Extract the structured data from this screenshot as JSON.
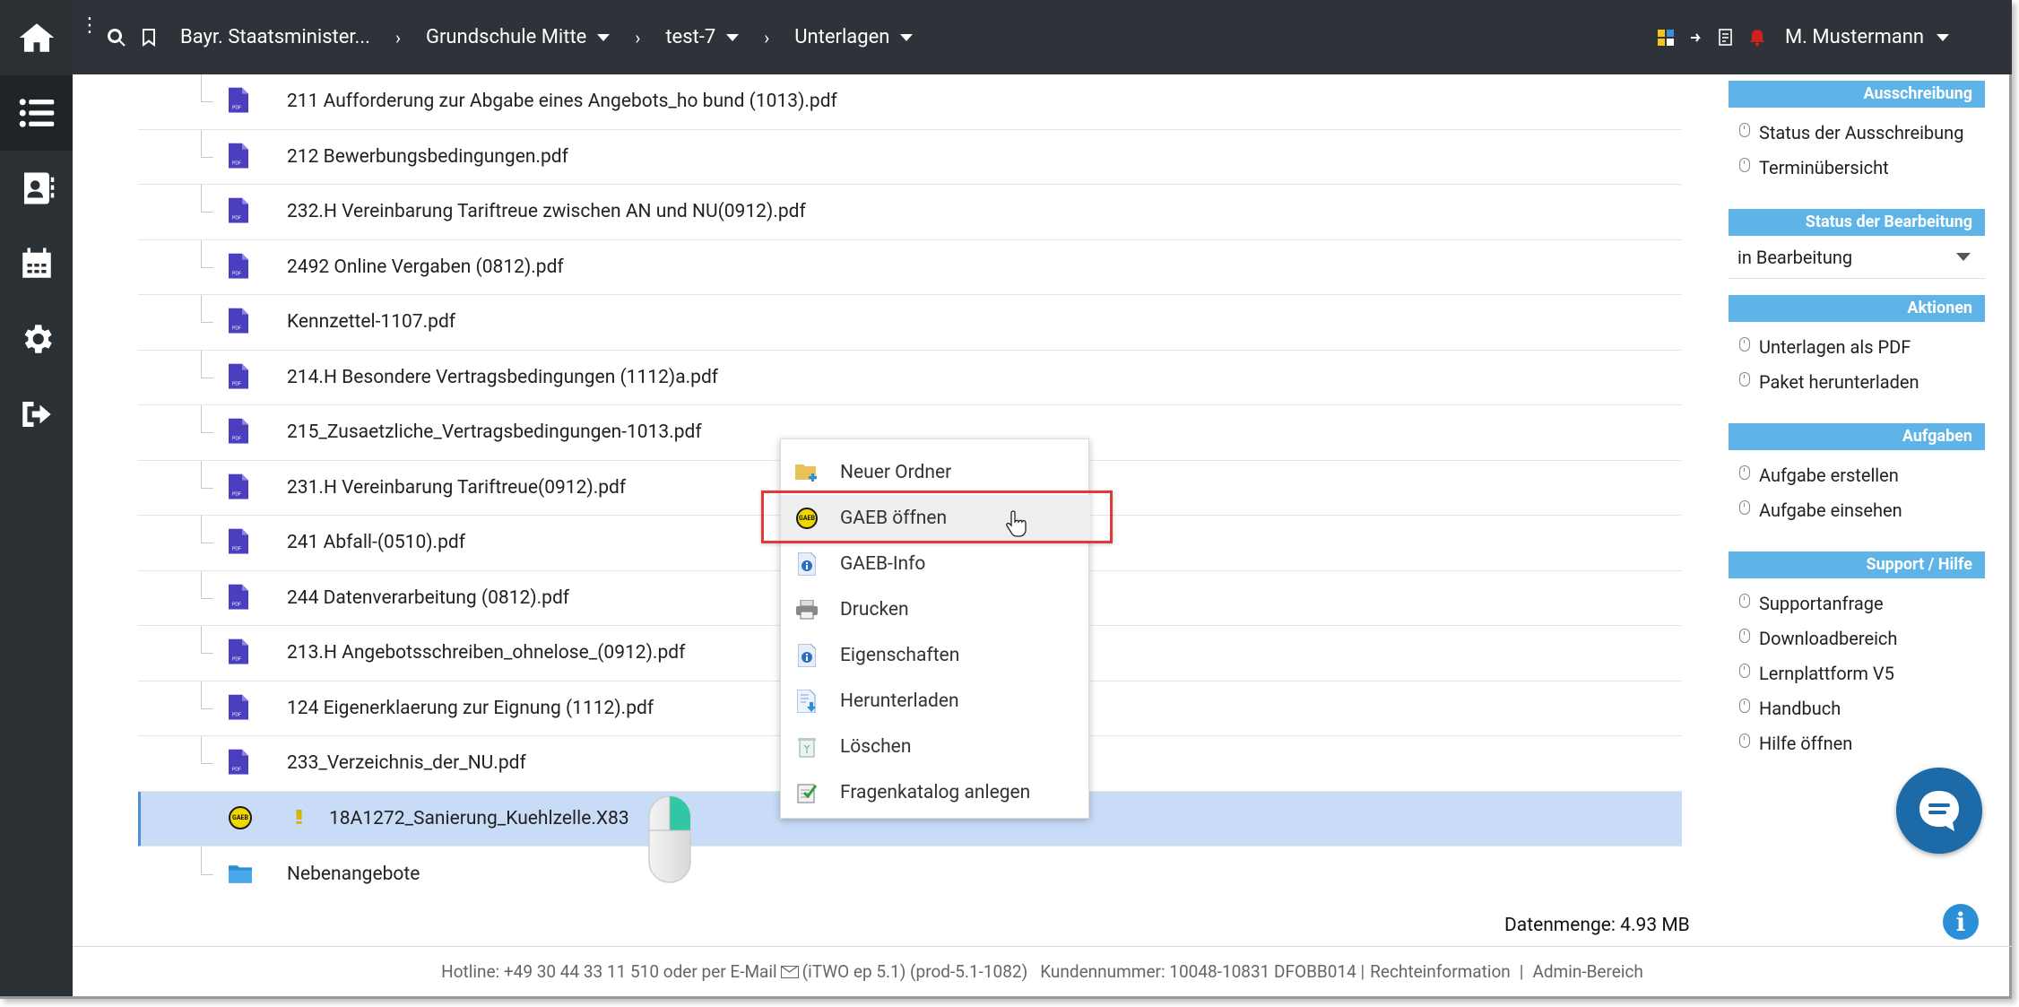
{
  "topbar": {
    "breadcrumbs": [
      {
        "label": "Bayr. Staatsminister...",
        "dropdown": false
      },
      {
        "label": "Grundschule Mitte",
        "dropdown": true
      },
      {
        "label": "test-7",
        "dropdown": true
      },
      {
        "label": "Unterlagen",
        "dropdown": true
      }
    ],
    "user": "M. Mustermann"
  },
  "leftnav": [
    "home-icon",
    "list-icon",
    "contacts-icon",
    "calendar-icon",
    "gear-icon",
    "logout-icon"
  ],
  "files": [
    {
      "name": "211 Aufforderung zur Abgabe eines Angebots_ho bund (1013).pdf",
      "type": "pdf"
    },
    {
      "name": "212 Bewerbungsbedingungen.pdf",
      "type": "pdf"
    },
    {
      "name": "232.H Vereinbarung Tariftreue zwischen AN und NU(0912).pdf",
      "type": "pdf"
    },
    {
      "name": "2492 Online Vergaben (0812).pdf",
      "type": "pdf"
    },
    {
      "name": "Kennzettel-1107.pdf",
      "type": "pdf"
    },
    {
      "name": "214.H Besondere Vertragsbedingungen (1112)a.pdf",
      "type": "pdf"
    },
    {
      "name": "215_Zusaetzliche_Vertragsbedingungen-1013.pdf",
      "type": "pdf"
    },
    {
      "name": "231.H Vereinbarung Tariftreue(0912).pdf",
      "type": "pdf"
    },
    {
      "name": "241 Abfall-(0510).pdf",
      "type": "pdf"
    },
    {
      "name": "244 Datenverarbeitung (0812).pdf",
      "type": "pdf"
    },
    {
      "name": "213.H Angebotsschreiben_ohnelose_(0912).pdf",
      "type": "pdf"
    },
    {
      "name": "124 Eigenerklaerung zur Eignung (1112).pdf",
      "type": "pdf"
    },
    {
      "name": "233_Verzeichnis_der_NU.pdf",
      "type": "pdf"
    },
    {
      "name": "18A1272_Sanierung_Kuehlzelle.X83",
      "type": "gaeb",
      "selected": true,
      "warning": "!!"
    },
    {
      "name": "Nebenangebote",
      "type": "folder"
    }
  ],
  "datenmenge": "Datenmenge: 4.93 MB",
  "footer": {
    "hotline": "Hotline: +49 30 44 33 11 510 oder per E-Mail",
    "version": "(iTWO ep 5.1) (prod-5.1-1082)",
    "kunde": "Kundennummer: 10048-10831 DFOBB014 |",
    "recht": "Rechteinformation",
    "pipe": "|",
    "admin": "Admin-Bereich"
  },
  "rightpanel": {
    "ausschreibung": {
      "title": "Ausschreibung",
      "items": [
        "Status der Ausschreibung",
        "Terminübersicht"
      ]
    },
    "status": {
      "title": "Status der Bearbeitung",
      "value": "in Bearbeitung"
    },
    "aktionen": {
      "title": "Aktionen",
      "items": [
        "Unterlagen als PDF",
        "Paket herunterladen"
      ]
    },
    "aufgaben": {
      "title": "Aufgaben",
      "items": [
        "Aufgabe erstellen",
        "Aufgabe einsehen"
      ]
    },
    "support": {
      "title": "Support / Hilfe",
      "items": [
        "Supportanfrage",
        "Downloadbereich",
        "Lernplattform V5",
        "Handbuch",
        "Hilfe öffnen"
      ]
    }
  },
  "contextmenu": [
    {
      "label": "Neuer Ordner",
      "icon": "new-folder-icon"
    },
    {
      "label": "GAEB öffnen",
      "icon": "gaeb-icon",
      "hover": true
    },
    {
      "label": "GAEB-Info",
      "icon": "info-doc-icon"
    },
    {
      "label": "Drucken",
      "icon": "printer-icon"
    },
    {
      "label": "Eigenschaften",
      "icon": "properties-icon"
    },
    {
      "label": "Herunterladen",
      "icon": "download-icon"
    },
    {
      "label": "Löschen",
      "icon": "trash-icon"
    },
    {
      "label": "Fragenkatalog anlegen",
      "icon": "checklist-icon"
    }
  ],
  "gaeb_icon_text": "GAEB",
  "colors": {
    "topbar": "#2d3339",
    "sidebar": "#2a3034",
    "section_header": "#5eb4e6",
    "selected_row": "#c8dcf8",
    "highlight": "#e03a3a"
  }
}
